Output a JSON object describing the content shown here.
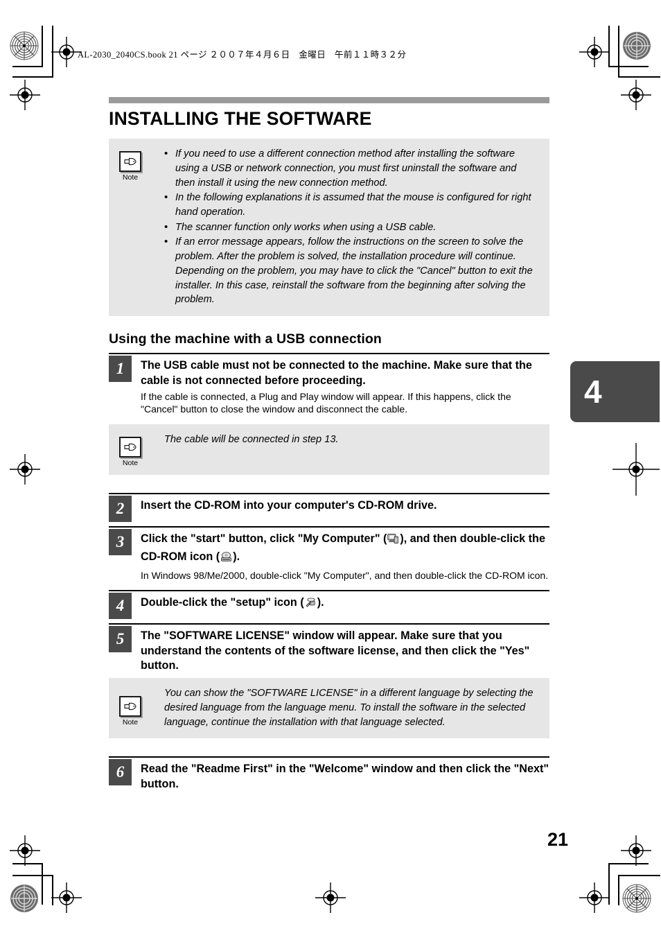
{
  "page": {
    "file_header": "AL-2030_2040CS.book  21 ページ  ２００７年４月６日　金曜日　午前１１時３２分",
    "number": "21",
    "chapter_tab": "4"
  },
  "header": {
    "title": "INSTALLING THE SOFTWARE"
  },
  "intro_note": {
    "icon_name": "pointing-hand-icon",
    "label": "Note",
    "bullets": [
      "If you need to use a different connection method after installing the software using a USB or network connection, you must first uninstall the software and then install it using the new connection method.",
      "In the following explanations it is assumed that the mouse is configured for right hand operation.",
      "The scanner function only works when using a USB cable.",
      "If an error message appears, follow the instructions on the screen to solve the problem. After the problem is solved, the installation procedure will continue. Depending on the problem, you may have to click the \"Cancel\" button to exit the installer. In this case, reinstall the software from the beginning after solving the problem."
    ]
  },
  "section": {
    "title": "Using the machine with a USB connection"
  },
  "steps": [
    {
      "number": "1",
      "head": "The USB cable must not be connected to the machine. Make sure that the cable is not connected before proceeding.",
      "sub": "If the cable is connected, a Plug and Play window will appear. If this happens, click the \"Cancel\" button to close the window and disconnect the cable."
    },
    {
      "number": "2",
      "head": "Insert the CD-ROM into your computer's CD-ROM drive.",
      "sub": ""
    },
    {
      "number": "3",
      "head_part1": "Click the \"start\" button, click \"My Computer\" (",
      "head_part2": "), and then double-click the CD-ROM icon (",
      "head_part3": ").",
      "icon1_name": "my-computer-icon",
      "icon2_name": "cd-rom-drive-icon",
      "sub": "In Windows 98/Me/2000, double-click \"My Computer\", and then double-click the CD-ROM icon."
    },
    {
      "number": "4",
      "head_part1": "Double-click the \"setup\" icon (",
      "head_part2": ").",
      "icon1_name": "setup-installer-icon",
      "sub": ""
    },
    {
      "number": "5",
      "head": "The \"SOFTWARE LICENSE\" window will appear. Make sure that you understand the contents of the software license, and then click the \"Yes\" button.",
      "sub": ""
    },
    {
      "number": "6",
      "head": "Read the \"Readme First\" in the \"Welcome\" window and then click the \"Next\" button.",
      "sub": ""
    }
  ],
  "note_step1": {
    "icon_name": "pointing-hand-icon",
    "label": "Note",
    "text": "The cable will be connected in step 13."
  },
  "note_step5": {
    "icon_name": "pointing-hand-icon",
    "label": "Note",
    "text": "You can show the \"SOFTWARE LICENSE\" in a different language by selecting the desired language from the language menu. To install the software in the selected language, continue the installation with that language selected."
  },
  "colors": {
    "title_rule": "#9a9a9a",
    "note_bg": "#e6e6e6",
    "step_num_bg": "#4a4a4a",
    "chapter_tab_bg": "#4a4a4a"
  }
}
